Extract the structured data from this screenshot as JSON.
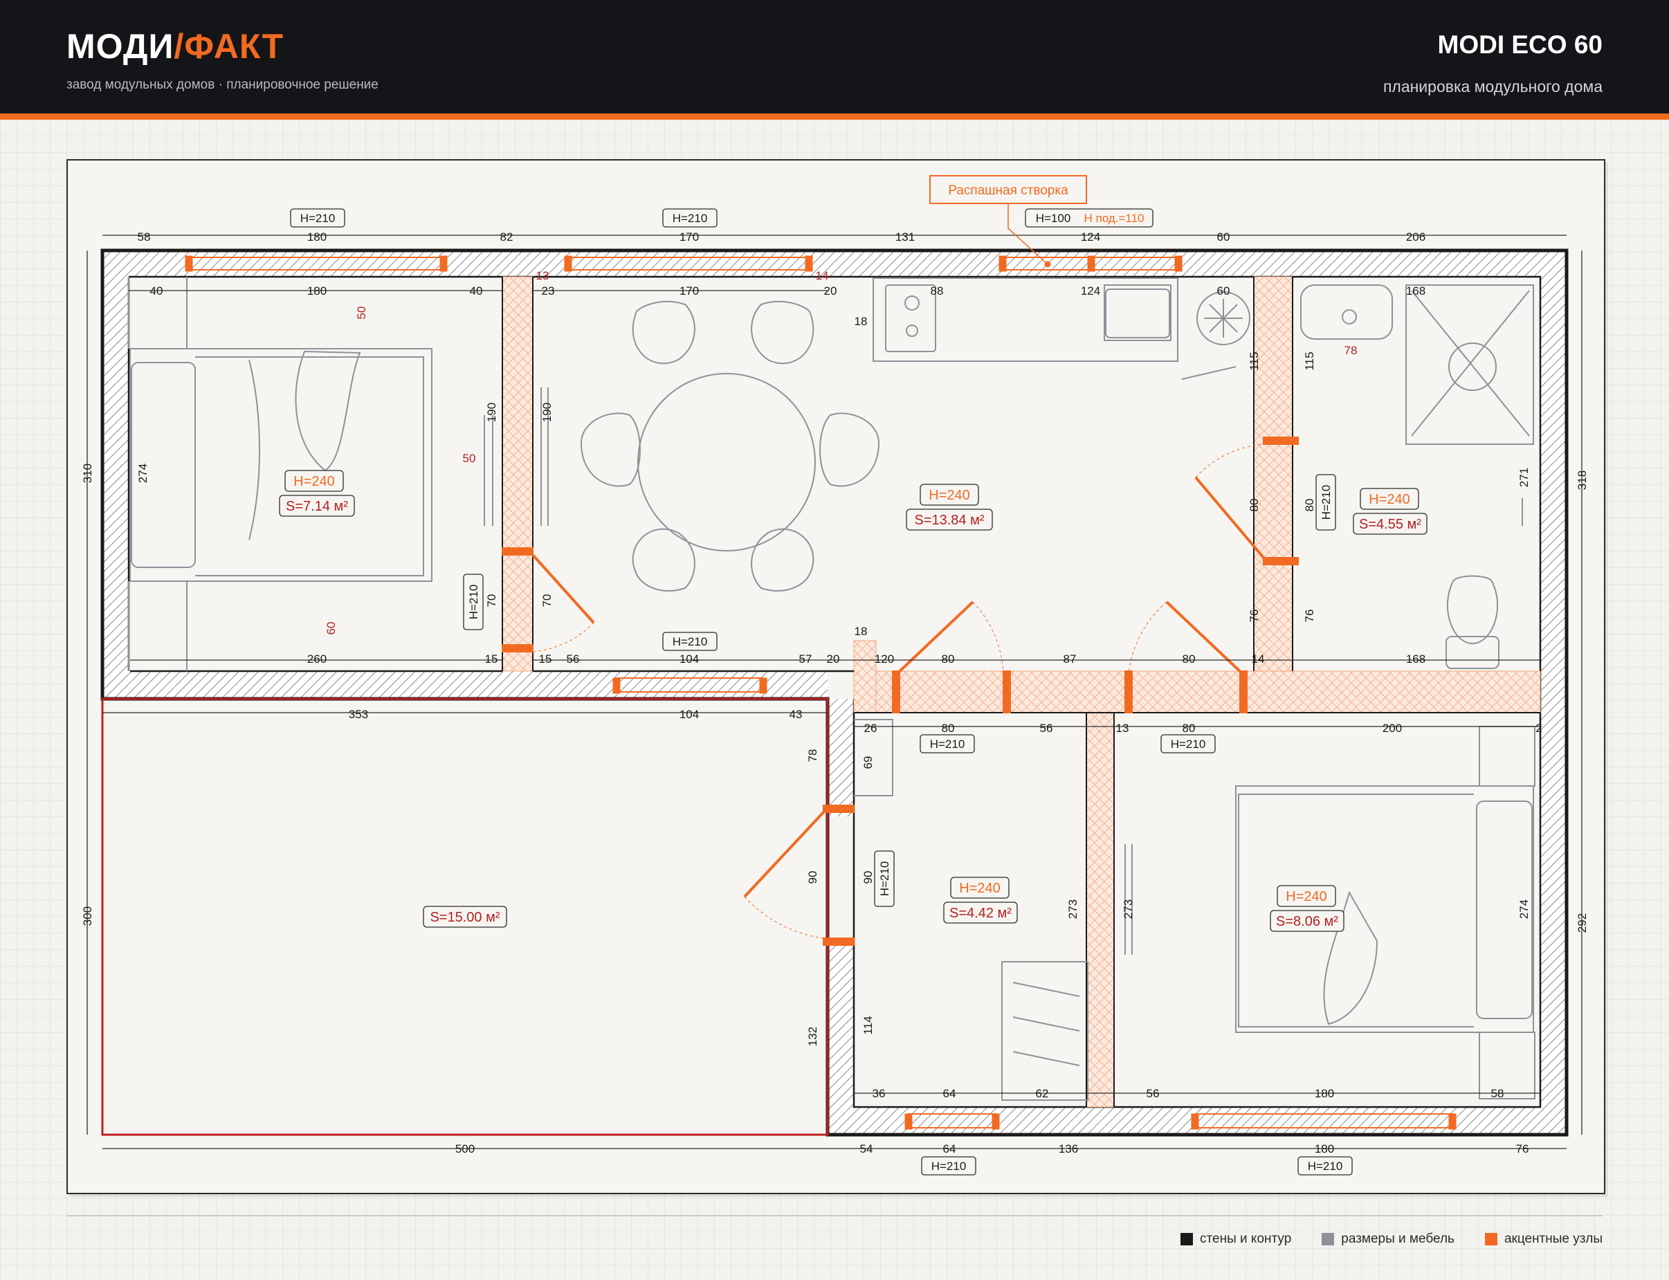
{
  "header": {
    "brand_main": "МОДИ",
    "brand_accent": "/ФАКТ",
    "brand_sub": "завод модульных домов · планировочное решение",
    "model": "MODI ECO 60",
    "model_sub": "планировка модульного дома"
  },
  "colors": {
    "wall": "#1a1a1a",
    "accent": "#f26a21",
    "room_label": "#b32020",
    "dimension": "#2b2b2b",
    "furniture": "#9a9ca3"
  },
  "callout": "Распашная створка",
  "rooms": {
    "bedroom1": {
      "height": "H=240",
      "area": "S=7.14 м²"
    },
    "living": {
      "height": "H=240",
      "area": "S=13.84 м²"
    },
    "bath": {
      "height": "H=240",
      "area": "S=4.55 м²"
    },
    "terrace": {
      "area": "S=15.00 м²"
    },
    "hall": {
      "height": "H=240",
      "area": "S=4.42 м²"
    },
    "bedroom2": {
      "height": "H=240",
      "area": "S=8.06 м²"
    }
  },
  "openings": {
    "win_top1": "H=210",
    "win_top2": "H=210",
    "win_top3": "H=100",
    "win_top3_sill": "H под.=110",
    "door_bed1": "H=210",
    "win_mid": "H=210",
    "door_hall": "H=210",
    "door_bed2": "H=210",
    "door_bath": "H=210",
    "door_entry": "H=210",
    "win_bot1": "H=210",
    "win_bot2": "H=210"
  },
  "dims": {
    "top_outer": [
      "58",
      "180",
      "82",
      "170",
      "131",
      "124",
      "60",
      "206"
    ],
    "top_inner": [
      "40",
      "180",
      "40",
      "23",
      "170",
      "20",
      "88",
      "124",
      "60",
      "168"
    ],
    "mid_upper": [
      "260",
      "15",
      "15",
      "56",
      "104",
      "57",
      "20",
      "120",
      "80",
      "87",
      "80",
      "14",
      "168"
    ],
    "mid_lower": [
      "353",
      "104",
      "43",
      "26",
      "80",
      "56",
      "13",
      "80",
      "200",
      "2"
    ],
    "bottom_inner": [
      "36",
      "64",
      "62",
      "56",
      "180",
      "58"
    ],
    "bottom_outer": [
      "500",
      "54",
      "64",
      "136",
      "180",
      "76"
    ],
    "left": [
      "310",
      "274",
      "300"
    ],
    "right": [
      "318",
      "271",
      "274",
      "292"
    ],
    "vertical_misc": [
      "50",
      "60",
      "190",
      "190",
      "70",
      "70",
      "13",
      "14",
      "18",
      "18",
      "115",
      "115",
      "80",
      "80",
      "76",
      "76",
      "78",
      "78",
      "69",
      "90",
      "90",
      "114",
      "132",
      "273",
      "273",
      "50"
    ]
  },
  "legend": [
    {
      "label": "стены и контур",
      "color": "#1a1a1a"
    },
    {
      "label": "размеры и мебель",
      "color": "#8f9199"
    },
    {
      "label": "акцентные узлы",
      "color": "#f26a21"
    }
  ]
}
